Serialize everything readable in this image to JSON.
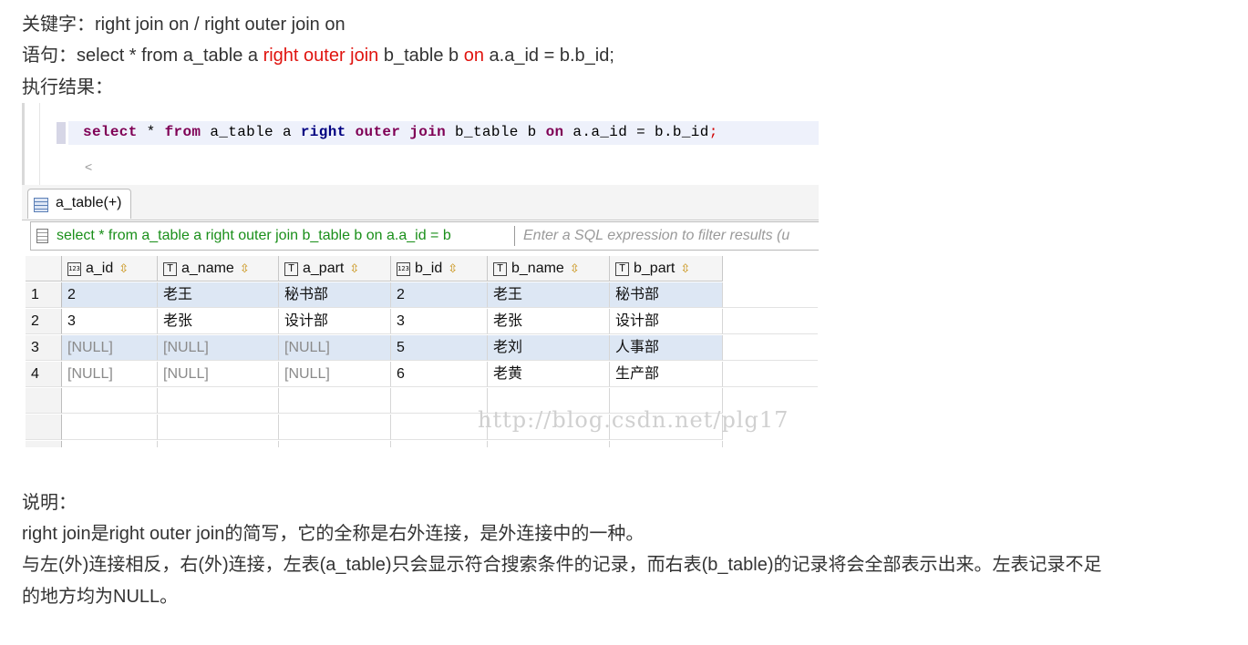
{
  "intro": {
    "keyword_label": "关键字：",
    "keywords": "right join on / right outer join on",
    "statement_label": "语句：",
    "statement_part1": "select * from a_table a ",
    "statement_kw1": "right outer join",
    "statement_part2": " b_table b ",
    "statement_kw2": "on",
    "statement_part3": " a.a_id = b.b_id;",
    "result_label": "执行结果："
  },
  "editor": {
    "sql_select": "select",
    "sql_star": " * ",
    "sql_from": "from",
    "sql_table_a": " a_table a ",
    "sql_right": "right",
    "sql_outer": " outer ",
    "sql_join": "join",
    "sql_table_b": " b_table b ",
    "sql_on": "on",
    "sql_cond": " a.a_id = b.b_id",
    "sql_semi": ";",
    "scroll_left": "<"
  },
  "tab": {
    "label": "a_table(+)"
  },
  "filter": {
    "query": "select * from a_table a right outer join b_table b on a.a_id = b",
    "placeholder": "Enter a SQL expression to filter results (u"
  },
  "table": {
    "columns": [
      {
        "name": "a_id",
        "type_icon": "123"
      },
      {
        "name": "a_name",
        "type_icon": "T"
      },
      {
        "name": "a_part",
        "type_icon": "T"
      },
      {
        "name": "b_id",
        "type_icon": "123"
      },
      {
        "name": "b_name",
        "type_icon": "T"
      },
      {
        "name": "b_part",
        "type_icon": "T"
      }
    ],
    "rows": [
      {
        "num": "1",
        "cells": [
          "2",
          "老王",
          "秘书部",
          "2",
          "老王",
          "秘书部"
        ]
      },
      {
        "num": "2",
        "cells": [
          "3",
          "老张",
          "设计部",
          "3",
          "老张",
          "设计部"
        ]
      },
      {
        "num": "3",
        "cells": [
          "[NULL]",
          "[NULL]",
          "[NULL]",
          "5",
          "老刘",
          "人事部"
        ]
      },
      {
        "num": "4",
        "cells": [
          "[NULL]",
          "[NULL]",
          "[NULL]",
          "6",
          "老黄",
          "生产部"
        ]
      }
    ]
  },
  "watermark": "http://blog.csdn.net/plg17",
  "notes": {
    "label": "说明：",
    "line1": "right join是right outer join的简写，它的全称是右外连接，是外连接中的一种。",
    "line2": "与左(外)连接相反，右(外)连接，左表(a_table)只会显示符合搜索条件的记录，而右表(b_table)的记录将会全部表示出来。左表记录不足",
    "line3": "的地方均为NULL。"
  }
}
